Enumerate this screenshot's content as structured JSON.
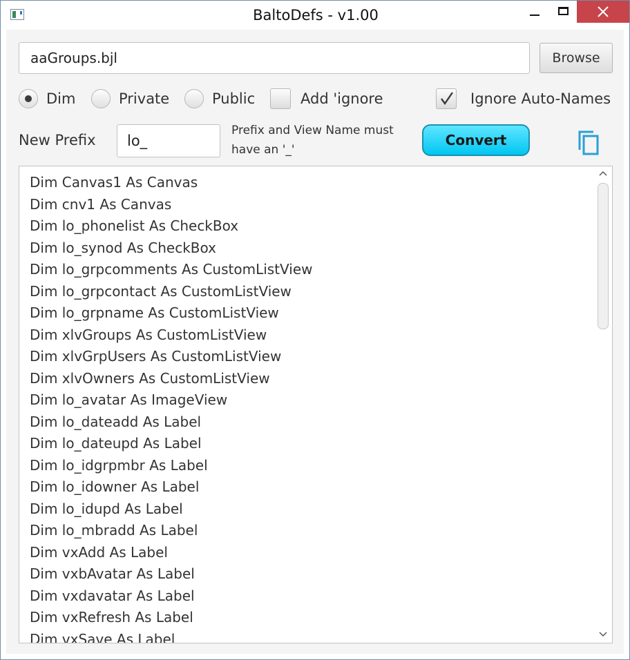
{
  "window": {
    "title": "BaltoDefs - v1.00"
  },
  "file": {
    "value": "aaGroups.bjl",
    "browse_label": "Browse"
  },
  "options": {
    "radios": [
      {
        "label": "Dim",
        "checked": true
      },
      {
        "label": "Private",
        "checked": false
      },
      {
        "label": "Public",
        "checked": false
      }
    ],
    "add_ignore": {
      "label": "Add 'ignore",
      "checked": false
    },
    "ignore_auto_names": {
      "label": "Ignore Auto-Names",
      "checked": true
    }
  },
  "prefix": {
    "label": "New Prefix",
    "value": "lo_",
    "note": "Prefix and View Name must have an '_'"
  },
  "convert_label": "Convert",
  "colors": {
    "convert_button": "#00c6f2",
    "close_button": "#c7454a",
    "copy_icon": "#2a9fd6"
  },
  "list": {
    "items": [
      "Dim Canvas1 As Canvas",
      "Dim cnv1 As Canvas",
      "Dim lo_phonelist As CheckBox",
      "Dim lo_synod As CheckBox",
      "Dim lo_grpcomments As CustomListView",
      "Dim lo_grpcontact As CustomListView",
      "Dim lo_grpname As CustomListView",
      "Dim xlvGroups As CustomListView",
      "Dim xlvGrpUsers As CustomListView",
      "Dim xlvOwners As CustomListView",
      "Dim lo_avatar As ImageView",
      "Dim lo_dateadd As Label",
      "Dim lo_dateupd As Label",
      "Dim lo_idgrpmbr As Label",
      "Dim lo_idowner As Label",
      "Dim lo_idupd As Label",
      "Dim lo_mbradd As Label",
      "Dim vxAdd As Label",
      "Dim vxbAvatar As Label",
      "Dim vxdavatar As Label",
      "Dim vxRefresh As Label",
      "Dim vxSave As Label"
    ]
  }
}
